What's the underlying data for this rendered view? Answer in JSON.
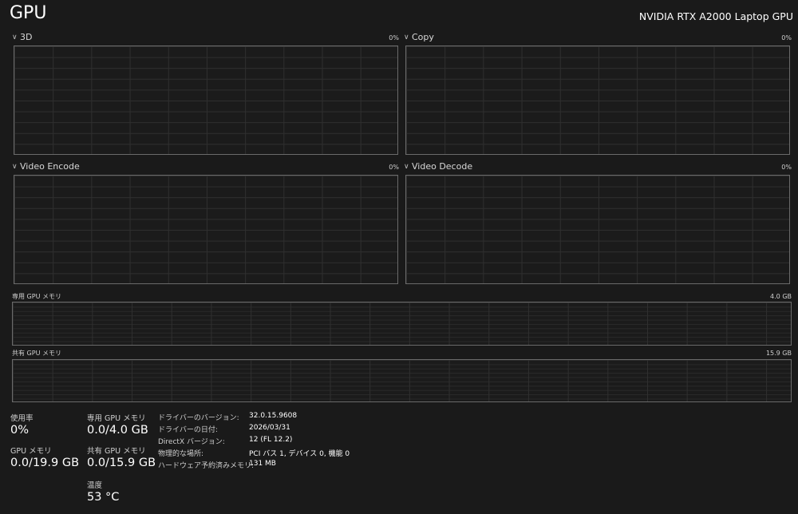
{
  "header": {
    "title": "GPU",
    "device_name": "NVIDIA RTX A2000 Laptop GPU"
  },
  "engines": [
    {
      "name": "3D",
      "percent": "0%",
      "usage": 0
    },
    {
      "name": "Copy",
      "percent": "0%",
      "usage": 0
    },
    {
      "name": "Video Encode",
      "percent": "0%",
      "usage": 0
    },
    {
      "name": "Video Decode",
      "percent": "0%",
      "usage": 0
    }
  ],
  "memory_graphs": {
    "dedicated": {
      "label": "専用 GPU メモリ",
      "max": "4.0 GB"
    },
    "shared": {
      "label": "共有 GPU メモリ",
      "max": "15.9 GB"
    }
  },
  "stats": {
    "utilization": {
      "label": "使用率",
      "value": "0%"
    },
    "gpu_memory": {
      "label": "GPU メモリ",
      "value": "0.0/19.9 GB"
    },
    "dedicated": {
      "label": "専用 GPU メモリ",
      "value": "0.0/4.0 GB"
    },
    "shared": {
      "label": "共有 GPU メモリ",
      "value": "0.0/15.9 GB"
    },
    "temperature": {
      "label": "温度",
      "value": "53 °C"
    }
  },
  "info": [
    {
      "key": "ドライバーのバージョン:",
      "value": "32.0.15.9608"
    },
    {
      "key": "ドライバーの日付:",
      "value": "2026/03/31"
    },
    {
      "key": "DirectX バージョン:",
      "value": "12 (FL 12.2)"
    },
    {
      "key": "物理的な場所:",
      "value": "PCI バス 1, デバイス 0, 機能 0"
    },
    {
      "key": "ハードウェア予約済みメモリ:",
      "value": "131 MB"
    }
  ],
  "icons": {
    "expand": "chevron-down-icon"
  }
}
